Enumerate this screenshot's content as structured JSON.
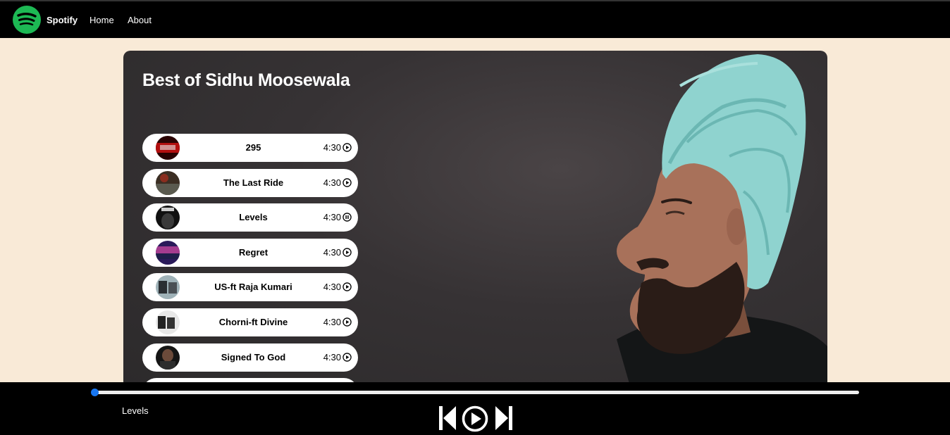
{
  "navbar": {
    "brand": "Spotify",
    "links": [
      "Home",
      "About"
    ],
    "logo_icon": "spotify-logo-icon"
  },
  "colors": {
    "accent": "#1db954",
    "page_bg": "#f9ead7",
    "bar_bg": "#000000",
    "progress_thumb": "#1877f2",
    "turban": "#8fd3cf"
  },
  "playlist": {
    "title": "Best of Sidhu Moosewala",
    "songs": [
      {
        "name": "295",
        "duration": "4:30",
        "state": "paused-item",
        "icon": "play-circle-icon"
      },
      {
        "name": "The Last Ride",
        "duration": "4:30",
        "icon": "play-circle-icon"
      },
      {
        "name": "Levels",
        "duration": "4:30",
        "icon": "pause-circle-icon"
      },
      {
        "name": "Regret",
        "duration": "4:30",
        "icon": "play-circle-icon"
      },
      {
        "name": "US-ft Raja Kumari",
        "duration": "4:30",
        "icon": "play-circle-icon"
      },
      {
        "name": "Chorni-ft Divine",
        "duration": "4:30",
        "icon": "play-circle-icon"
      },
      {
        "name": "Signed To God",
        "duration": "4:30",
        "icon": "play-circle-icon"
      }
    ]
  },
  "player": {
    "now_playing": "Levels",
    "progress": 0.0,
    "controls": [
      "previous-icon",
      "play-circle-icon",
      "next-icon"
    ]
  }
}
